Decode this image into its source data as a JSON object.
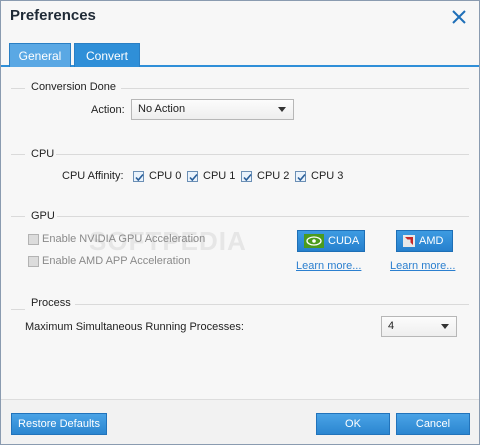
{
  "window": {
    "title": "Preferences"
  },
  "tabs": [
    {
      "label": "General"
    },
    {
      "label": "Convert"
    }
  ],
  "watermark": "SOFTPEDIA",
  "conversion_done": {
    "title": "Conversion Done",
    "action_label": "Action:",
    "action_value": "No Action"
  },
  "cpu": {
    "title": "CPU",
    "affinity_label": "CPU Affinity:",
    "cores": [
      {
        "label": "CPU 0",
        "checked": true
      },
      {
        "label": "CPU 1",
        "checked": true
      },
      {
        "label": "CPU 2",
        "checked": true
      },
      {
        "label": "CPU 3",
        "checked": true
      }
    ]
  },
  "gpu": {
    "title": "GPU",
    "nvidia_label": "Enable NVIDIA GPU Acceleration",
    "amd_label": "Enable AMD APP Acceleration",
    "cuda_button": "CUDA",
    "amd_button": "AMD",
    "learn_more": "Learn more..."
  },
  "process": {
    "title": "Process",
    "max_label": "Maximum Simultaneous Running Processes:",
    "max_value": "4"
  },
  "footer": {
    "restore_label": "Restore Defaults",
    "ok_label": "OK",
    "cancel_label": "Cancel"
  },
  "colors": {
    "accent": "#2f8fd8",
    "link": "#2b7fcf"
  }
}
